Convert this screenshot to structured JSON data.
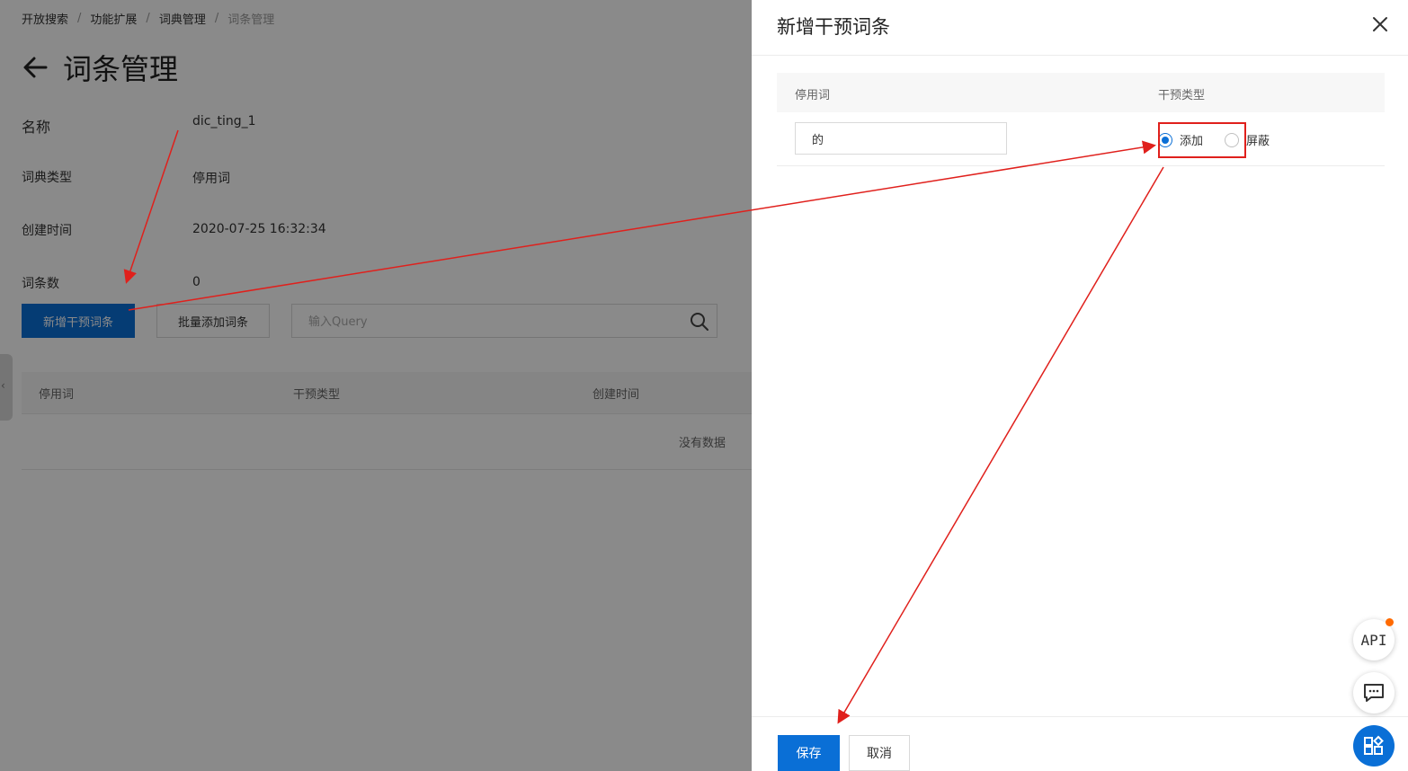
{
  "breadcrumb": [
    "开放搜索",
    "功能扩展",
    "词典管理",
    "词条管理"
  ],
  "page_title": "词条管理",
  "info": [
    {
      "label": "名称",
      "value": "dic_ting_1"
    },
    {
      "label": "词典类型",
      "value": "停用词"
    },
    {
      "label": "创建时间",
      "value": "2020-07-25 16:32:34"
    },
    {
      "label": "词条数",
      "value": "0"
    }
  ],
  "toolbar": {
    "add_label": "新增干预词条",
    "batch_label": "批量添加词条",
    "search_placeholder": "输入Query"
  },
  "table": {
    "columns": [
      "停用词",
      "干预类型",
      "创建时间"
    ],
    "empty_text": "没有数据"
  },
  "drawer": {
    "title": "新增干预词条",
    "columns": [
      "停用词",
      "干预类型"
    ],
    "word_value": "的",
    "options": [
      "添加",
      "屏蔽"
    ],
    "selected": "添加",
    "save_label": "保存",
    "cancel_label": "取消"
  },
  "float": {
    "api_label": "API"
  },
  "colors": {
    "primary": "#0a6fd6",
    "annotation": "#e0201c",
    "badge": "#ff6a00"
  }
}
